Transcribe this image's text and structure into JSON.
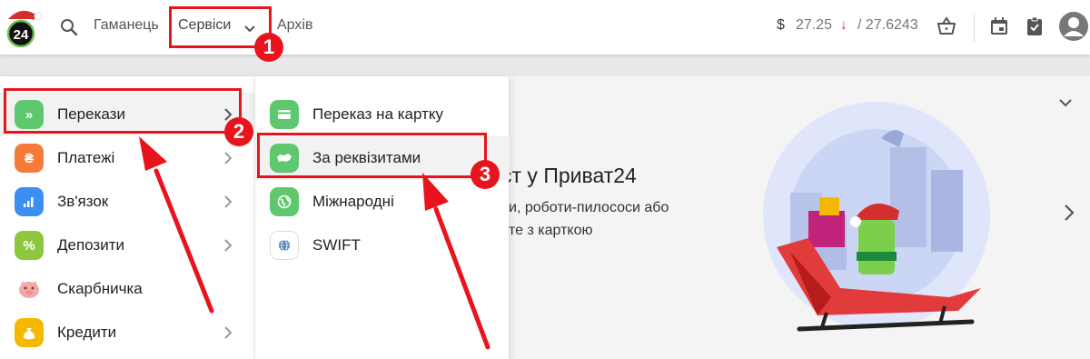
{
  "header": {
    "logo_text": "24",
    "nav": {
      "wallet": "Гаманець",
      "services": "Сервіси",
      "archive": "Архів"
    },
    "rate": {
      "currency": "$",
      "buy": "27.25",
      "arrow": "↓",
      "sell": "/ 27.6243"
    },
    "icons": [
      "search-icon",
      "chevron-down-icon",
      "basket-icon",
      "calendar-icon",
      "clipboard-check-icon",
      "user-avatar-icon"
    ]
  },
  "menu": {
    "categories": [
      {
        "label": "Перекази",
        "icon": "transfer-icon",
        "color": "#5fc86f",
        "has_submenu": true,
        "active": true
      },
      {
        "label": "Платежі",
        "icon": "payments-icon",
        "color": "#f47b3a",
        "has_submenu": true
      },
      {
        "label": "Зв'язок",
        "icon": "signal-icon",
        "color": "#3b8ff0",
        "has_submenu": true
      },
      {
        "label": "Депозити",
        "icon": "percent-icon",
        "color": "#8dc63f",
        "has_submenu": true
      },
      {
        "label": "Скарбничка",
        "icon": "piggy-bank-icon",
        "color": "#f6a7a7",
        "has_submenu": false
      },
      {
        "label": "Кредити",
        "icon": "money-bag-icon",
        "color": "#f5b800",
        "has_submenu": true
      }
    ],
    "submenu": [
      {
        "label": "Переказ на картку",
        "icon": "card-icon",
        "color": "#5fc86f"
      },
      {
        "label": "За реквізитами",
        "icon": "ukraine-map-icon",
        "color": "#5fc86f",
        "active": true
      },
      {
        "label": "Міжнародні",
        "icon": "globe-icon",
        "color": "#5fc86f"
      },
      {
        "label": "SWIFT",
        "icon": "swift-icon",
        "color": "#ffffff"
      }
    ]
  },
  "promo": {
    "title_fragment": "ст у Приват24",
    "line1_fragment": "и, роботи-пилососи або",
    "line2_fragment": "те з карткою"
  },
  "annotations": [
    {
      "number": "1"
    },
    {
      "number": "2"
    },
    {
      "number": "3"
    }
  ],
  "colors": {
    "accent_red": "#e8141d",
    "brand_green": "#5fc86f",
    "rate_down": "#e53935"
  }
}
